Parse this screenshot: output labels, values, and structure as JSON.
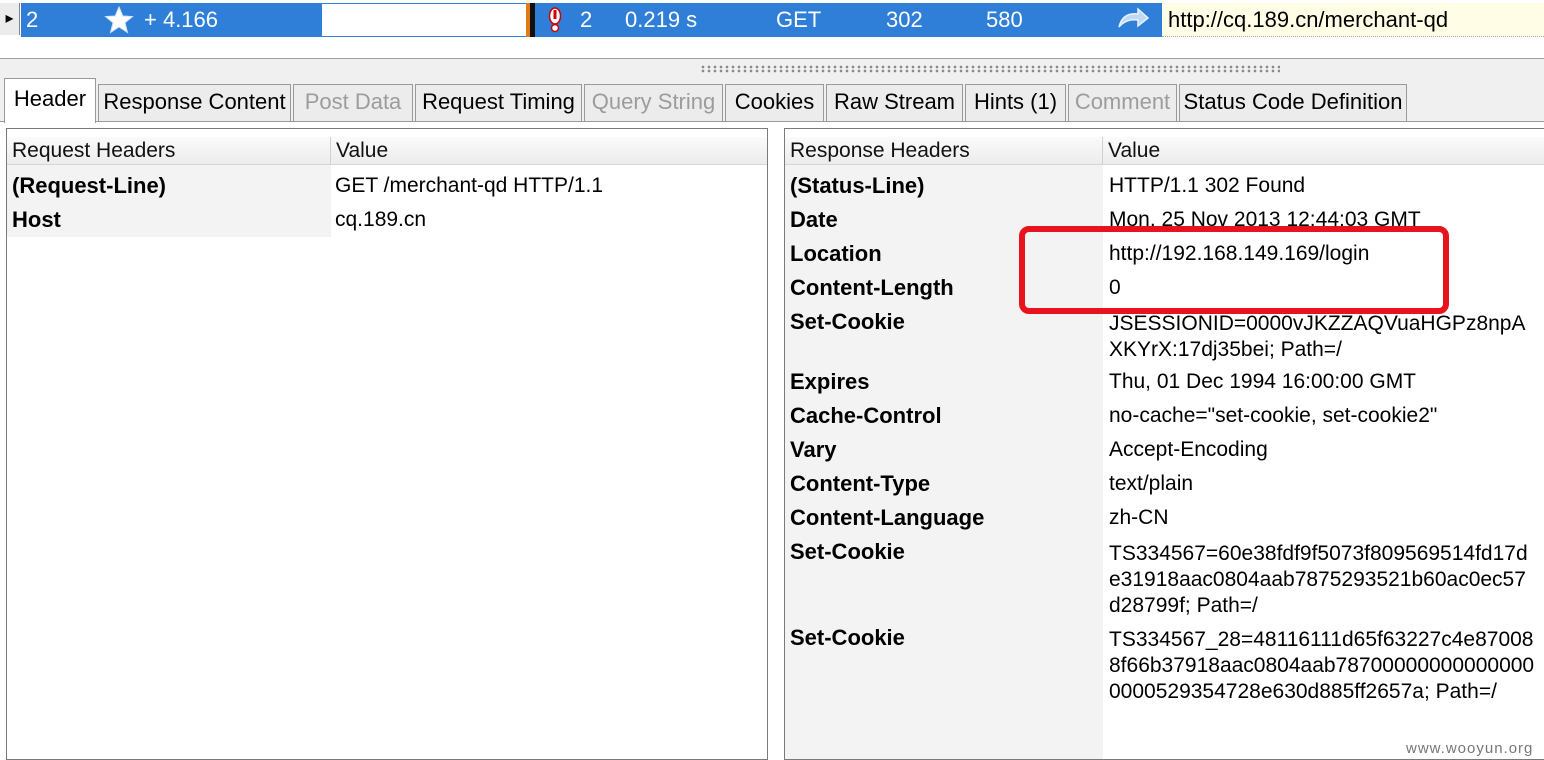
{
  "request_row": {
    "expander_glyph": "▸",
    "index": "2",
    "star_icon": "star-icon",
    "delta": "+ 4.166",
    "alert_icon": "alert-icon",
    "alert_count": "2",
    "duration": "0.219 s",
    "method": "GET",
    "status": "302",
    "size": "580",
    "redirect_icon": "redirect-arrow-icon",
    "url": "http://cq.189.cn/merchant-qd",
    "band_color": "#2f7fd8"
  },
  "tabs": [
    {
      "label": "Header",
      "state": "active"
    },
    {
      "label": "Response Content",
      "state": "normal"
    },
    {
      "label": "Post Data",
      "state": "disabled"
    },
    {
      "label": "Request Timing",
      "state": "normal"
    },
    {
      "label": "Query String",
      "state": "disabled"
    },
    {
      "label": "Cookies",
      "state": "normal"
    },
    {
      "label": "Raw Stream",
      "state": "normal"
    },
    {
      "label": "Hints (1)",
      "state": "normal"
    },
    {
      "label": "Comment",
      "state": "disabled"
    },
    {
      "label": "Status Code Definition",
      "state": "normal"
    }
  ],
  "request_headers": {
    "col_name": "Request Headers",
    "col_value": "Value",
    "rows": [
      {
        "name": "(Request-Line)",
        "value": "GET /merchant-qd HTTP/1.1"
      },
      {
        "name": "Host",
        "value": "cq.189.cn"
      }
    ]
  },
  "response_headers": {
    "col_name": "Response Headers",
    "col_value": "Value",
    "rows": [
      {
        "name": "(Status-Line)",
        "value": "HTTP/1.1 302 Found"
      },
      {
        "name": "Date",
        "value": "Mon, 25 Nov 2013 12:44:03 GMT"
      },
      {
        "name": "Location",
        "value": "http://192.168.149.169/login"
      },
      {
        "name": "Content-Length",
        "value": "0"
      },
      {
        "name": "Set-Cookie",
        "value": "JSESSIONID=0000vJKZZAQVuaHGPz8npAXKYrX:17dj35bei; Path=/"
      },
      {
        "name": "Expires",
        "value": "Thu, 01 Dec 1994 16:00:00 GMT"
      },
      {
        "name": "Cache-Control",
        "value": "no-cache=\"set-cookie, set-cookie2\""
      },
      {
        "name": "Vary",
        "value": "Accept-Encoding"
      },
      {
        "name": "Content-Type",
        "value": "text/plain"
      },
      {
        "name": "Content-Language",
        "value": "zh-CN"
      },
      {
        "name": "Set-Cookie",
        "value": "TS334567=60e38fdf9f5073f809569514fd17de31918aac0804aab7875293521b60ac0ec57d28799f; Path=/"
      },
      {
        "name": "Set-Cookie",
        "value": "TS334567_28=48116111d65f63227c4e870088f66b37918aac0804aab787000000000000000000529354728e630d885ff2657a; Path=/"
      }
    ]
  },
  "highlight_color": "#e8141d",
  "watermark": "www.wooyun.org"
}
